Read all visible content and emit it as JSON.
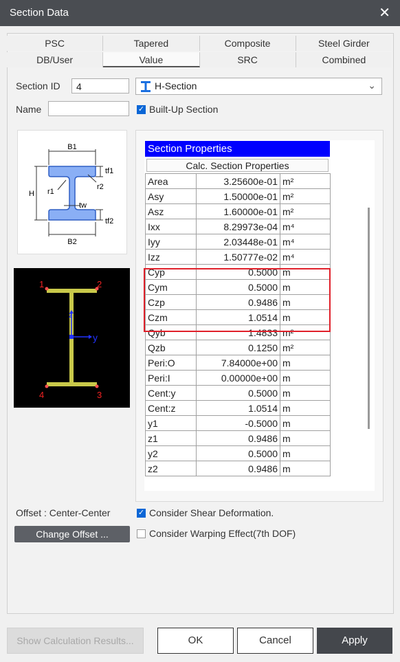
{
  "window": {
    "title": "Section Data"
  },
  "tabs_top": [
    "PSC",
    "Tapered",
    "Composite",
    "Steel Girder"
  ],
  "tabs_bottom": [
    "DB/User",
    "Value",
    "SRC",
    "Combined"
  ],
  "active_tab": "Value",
  "form": {
    "section_id_label": "Section ID",
    "section_id_value": "4",
    "section_type": "H-Section",
    "name_label": "Name",
    "name_value": "",
    "built_up_label": "Built-Up Section",
    "built_up_checked": true
  },
  "schematic": {
    "b1": "B1",
    "b2": "B2",
    "h": "H",
    "tf1": "tf1",
    "tf2": "tf2",
    "tw": "tw",
    "r1": "r1",
    "r2": "r2"
  },
  "preview": {
    "points": [
      "1",
      "2",
      "3",
      "4"
    ],
    "axis_y": "y",
    "axis_z": "z"
  },
  "properties": {
    "header": "Section Properties",
    "calc_button": "Calc. Section Properties",
    "rows": [
      {
        "name": "Area",
        "value": "3.25600e-01",
        "unit": "m²"
      },
      {
        "name": "Asy",
        "value": "1.50000e-01",
        "unit": "m²"
      },
      {
        "name": "Asz",
        "value": "1.60000e-01",
        "unit": "m²"
      },
      {
        "name": "Ixx",
        "value": "8.29973e-04",
        "unit": "m⁴"
      },
      {
        "name": "Iyy",
        "value": "2.03448e-01",
        "unit": "m⁴"
      },
      {
        "name": "Izz",
        "value": "1.50777e-02",
        "unit": "m⁴"
      },
      {
        "name": "Cyp",
        "value": "0.5000",
        "unit": "m"
      },
      {
        "name": "Cym",
        "value": "0.5000",
        "unit": "m"
      },
      {
        "name": "Czp",
        "value": "0.9486",
        "unit": "m"
      },
      {
        "name": "Czm",
        "value": "1.0514",
        "unit": "m"
      },
      {
        "name": "Qyb",
        "value": "1.4833",
        "unit": "m²"
      },
      {
        "name": "Qzb",
        "value": "0.1250",
        "unit": "m²"
      },
      {
        "name": "Peri:O",
        "value": "7.84000e+00",
        "unit": "m"
      },
      {
        "name": "Peri:I",
        "value": "0.00000e+00",
        "unit": "m"
      },
      {
        "name": "Cent:y",
        "value": "0.5000",
        "unit": "m"
      },
      {
        "name": "Cent:z",
        "value": "1.0514",
        "unit": "m"
      },
      {
        "name": "y1",
        "value": "-0.5000",
        "unit": "m"
      },
      {
        "name": "z1",
        "value": "0.9486",
        "unit": "m"
      },
      {
        "name": "y2",
        "value": "0.5000",
        "unit": "m"
      },
      {
        "name": "z2",
        "value": "0.9486",
        "unit": "m"
      }
    ]
  },
  "offset": {
    "label": "Offset : Center-Center",
    "button": "Change Offset ..."
  },
  "options": {
    "shear_label": "Consider Shear Deformation.",
    "shear_checked": true,
    "warping_label": "Consider Warping Effect(7th DOF)",
    "warping_checked": false
  },
  "buttons": {
    "show_calc": "Show Calculation Results...",
    "ok": "OK",
    "cancel": "Cancel",
    "apply": "Apply"
  },
  "colors": {
    "header_blue": "#0000ff",
    "highlight": "#e0202a",
    "accent": "#0a66d6",
    "section_fill": "#8aaff5",
    "preview_line": "#c9c94a"
  }
}
